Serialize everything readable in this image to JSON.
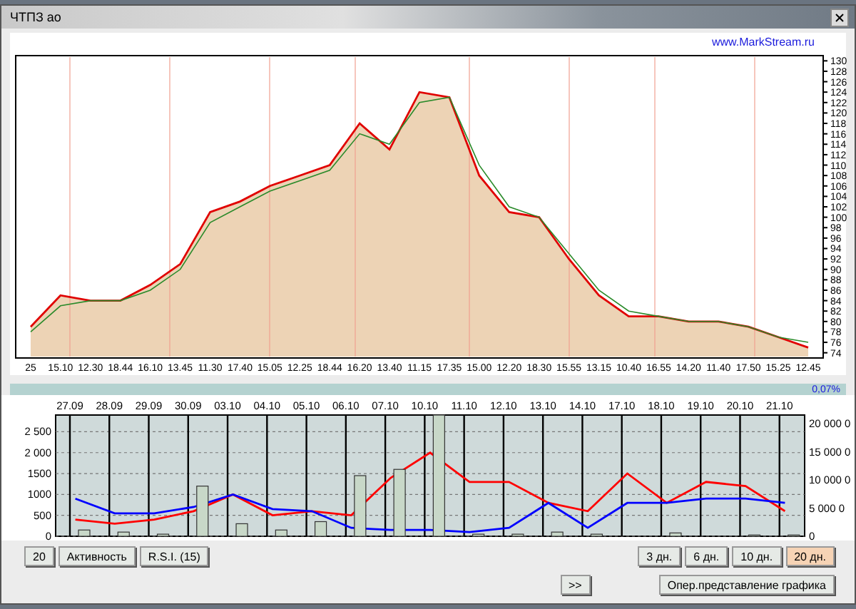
{
  "window": {
    "title": "ЧТПЗ ао"
  },
  "link": "www.MarkStream.ru",
  "price_chart": {
    "chart_data": {
      "type": "area",
      "grid": true,
      "categories": [
        "25",
        "15.10",
        "12.30",
        "18.44",
        "16.10",
        "13.45",
        "11.30",
        "17.40",
        "15.05",
        "12.25",
        "18.44",
        "16.20",
        "13.40",
        "11.15",
        "17.35",
        "15.00",
        "12.20",
        "18.30",
        "15.55",
        "13.15",
        "10.40",
        "16.55",
        "14.20",
        "11.40",
        "17.50",
        "15.25",
        "12.45"
      ],
      "series": [
        {
          "color": "#e00000",
          "values": [
            79,
            85,
            84,
            84,
            87,
            91,
            101,
            103,
            106,
            108,
            110,
            118,
            113,
            124,
            123,
            108,
            101,
            100,
            92,
            85,
            81,
            81,
            80,
            80,
            79,
            77,
            75
          ]
        },
        {
          "type": "line",
          "color": "#2a8a2a",
          "values": [
            78,
            83,
            84,
            84,
            86,
            90,
            99,
            102,
            105,
            107,
            109,
            116,
            114,
            122,
            123,
            110,
            102,
            100,
            93,
            86,
            82,
            81,
            80,
            80,
            79,
            77,
            76
          ]
        }
      ],
      "ylim": [
        73,
        131
      ],
      "yticks": [
        74,
        76,
        78,
        80,
        82,
        84,
        86,
        88,
        90,
        92,
        94,
        96,
        98,
        100,
        102,
        104,
        106,
        108,
        110,
        112,
        114,
        116,
        118,
        120,
        122,
        124,
        126,
        128,
        130
      ]
    }
  },
  "change": "0,07%",
  "activity_chart": {
    "chart_data": {
      "type": "line",
      "categories": [
        "27.09",
        "28.09",
        "29.09",
        "30.09",
        "03.10",
        "04.10",
        "05.10",
        "06.10",
        "07.10",
        "10.10",
        "11.10",
        "12.10",
        "13.10",
        "14.10",
        "17.10",
        "18.10",
        "19.10",
        "20.10",
        "21.10"
      ],
      "series": [
        {
          "color": "#ff0000",
          "values": [
            400,
            300,
            400,
            600,
            1000,
            500,
            600,
            500,
            1400,
            2000,
            1300,
            1300,
            800,
            600,
            1500,
            800,
            1300,
            1200,
            600
          ]
        },
        {
          "color": "#0000ff",
          "values": [
            900,
            550,
            550,
            700,
            1000,
            650,
            600,
            200,
            150,
            150,
            100,
            200,
            800,
            200,
            800,
            800,
            900,
            900,
            800
          ]
        },
        {
          "type": "bar",
          "color": "#c8d8c8",
          "values": [
            150,
            100,
            50,
            1200,
            300,
            150,
            350,
            1450,
            1600,
            2900,
            50,
            50,
            100,
            50,
            null,
            80,
            null,
            30,
            30
          ]
        }
      ],
      "grid": true,
      "ylim": [
        0,
        2900
      ],
      "yticks": [
        0,
        {
          "value": 500,
          "label": "500"
        },
        {
          "value": 1000,
          "label": "1000"
        },
        {
          "value": 1500,
          "label": "1500"
        },
        {
          "value": 2000,
          "label": "2 000"
        },
        {
          "value": 2500,
          "label": "2 500"
        }
      ]
    },
    "right_axis_labels": [
      "20 000 0",
      "15 000 0",
      "10 000 0",
      "5 000 0",
      "0"
    ]
  },
  "buttons": [
    {
      "label": "20"
    },
    {
      "label": "Активность"
    },
    {
      "label": "R.S.I. (15)"
    }
  ],
  "periods": [
    {
      "label": "3 дн.",
      "selected": false
    },
    {
      "label": "6 дн.",
      "selected": false
    },
    {
      "label": "10 дн.",
      "selected": false
    },
    {
      "label": "20 дн.",
      "selected": true
    }
  ],
  "actions": [
    {
      "label": ">>"
    },
    {
      "label": "Опер.представление графика"
    }
  ]
}
